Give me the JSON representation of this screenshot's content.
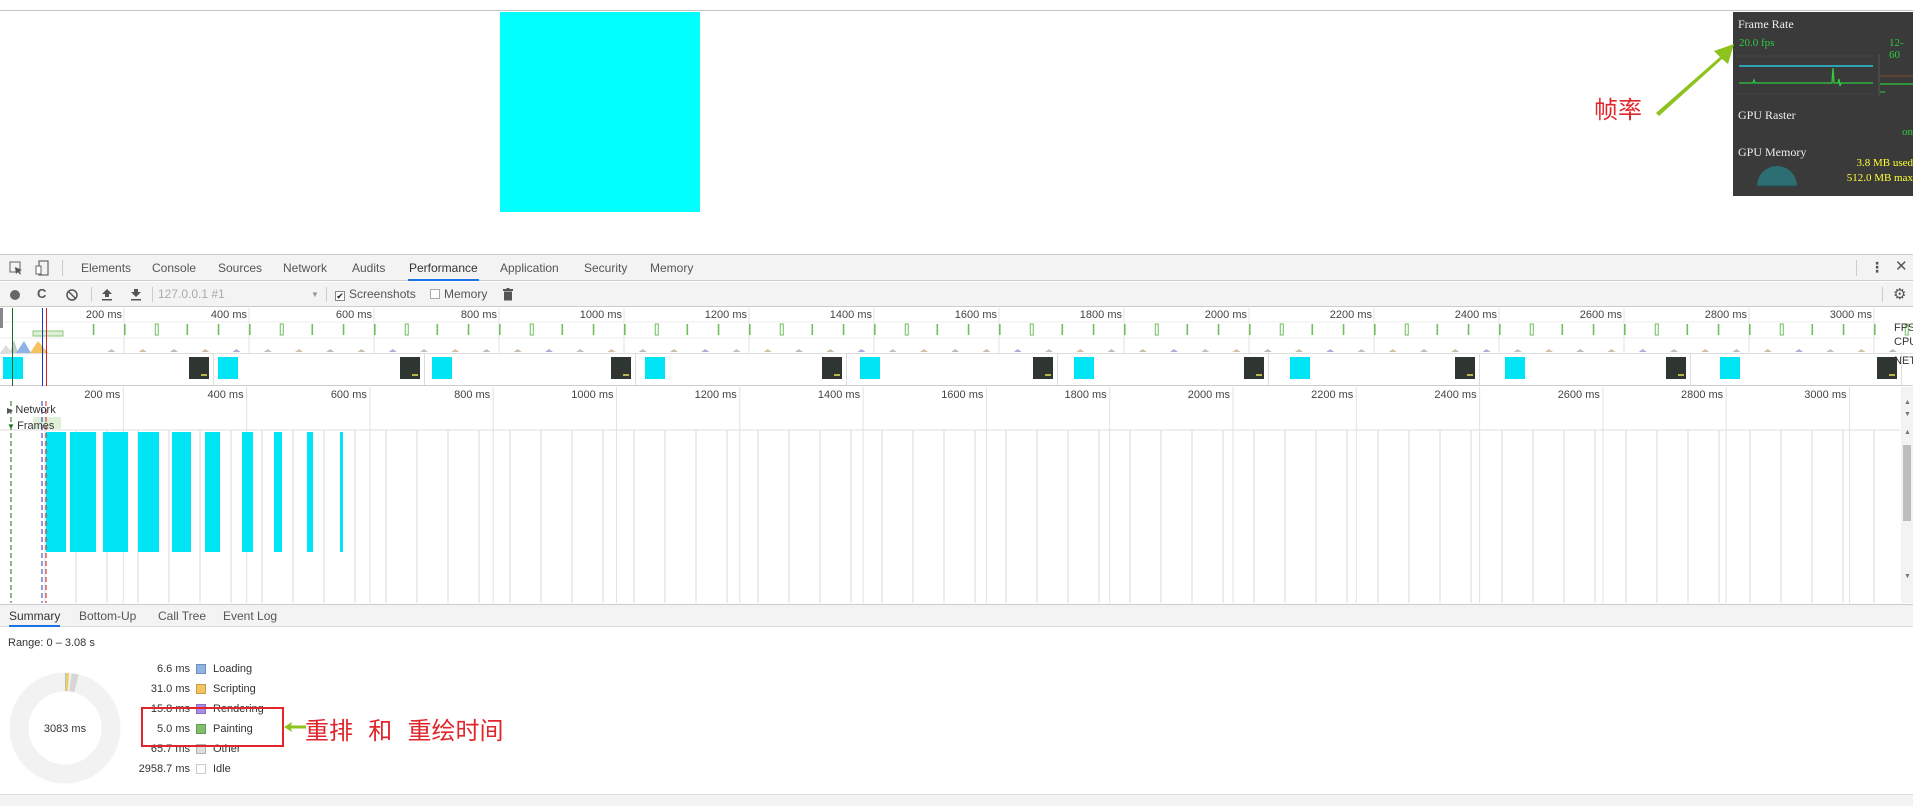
{
  "page": {
    "viewport_box_color": "#00ffff"
  },
  "fps_meter": {
    "title": "Frame Rate",
    "fps": "20.0 fps",
    "range": "12-60",
    "gpu_raster_label": "GPU Raster",
    "gpu_raster_status": "on",
    "gpu_memory_label": "GPU Memory",
    "memory_used": "3.8 MB used",
    "memory_max": "512.0 MB max"
  },
  "annotations": {
    "frame_rate_note": "帧率",
    "reflow_repaint_note": "重排  和  重绘时间",
    "color": "#e0262b",
    "arrow_color": "#8dc21f"
  },
  "devtools": {
    "tabs": [
      {
        "label": "Elements",
        "active": false
      },
      {
        "label": "Console",
        "active": false
      },
      {
        "label": "Sources",
        "active": false
      },
      {
        "label": "Network",
        "active": false
      },
      {
        "label": "Audits",
        "active": false
      },
      {
        "label": "Performance",
        "active": true
      },
      {
        "label": "Application",
        "active": false
      },
      {
        "label": "Security",
        "active": false
      },
      {
        "label": "Memory",
        "active": false
      }
    ],
    "toolbar": {
      "profile_select": "127.0.0.1 #1",
      "screenshots_label": "Screenshots",
      "screenshots_checked": true,
      "memory_label": "Memory",
      "memory_checked": false
    },
    "overview_labels": {
      "fps": "FPS",
      "cpu": "CPU",
      "net": "NET"
    },
    "ruler_ticks": [
      "200 ms",
      "400 ms",
      "600 ms",
      "800 ms",
      "1000 ms",
      "1200 ms",
      "1400 ms",
      "1600 ms",
      "1800 ms",
      "2000 ms",
      "2200 ms",
      "2400 ms",
      "2600 ms",
      "2800 ms",
      "3000 ms"
    ],
    "ruler_tick_values_ms": [
      200,
      400,
      600,
      800,
      1000,
      1200,
      1400,
      1600,
      1800,
      2000,
      2200,
      2400,
      2600,
      2800,
      3000
    ],
    "tracks": {
      "network": "Network",
      "frames": "Frames"
    },
    "bottom_tabs": [
      {
        "label": "Summary",
        "active": true
      },
      {
        "label": "Bottom-Up",
        "active": false
      },
      {
        "label": "Call Tree",
        "active": false
      },
      {
        "label": "Event Log",
        "active": false
      }
    ],
    "summary": {
      "range": "Range: 0 – 3.08 s",
      "total": "3083 ms",
      "items": [
        {
          "value": "6.6 ms",
          "name": "Loading",
          "color": "#8fb4e3"
        },
        {
          "value": "31.0 ms",
          "name": "Scripting",
          "color": "#f5c45e"
        },
        {
          "value": "15.8 ms",
          "name": "Rendering",
          "color": "#a98ce8"
        },
        {
          "value": "5.0 ms",
          "name": "Painting",
          "color": "#7fbf6a"
        },
        {
          "value": "65.7 ms",
          "name": "Other",
          "color": "#dedede"
        },
        {
          "value": "2958.7 ms",
          "name": "Idle",
          "color": "#ffffff"
        }
      ]
    }
  }
}
